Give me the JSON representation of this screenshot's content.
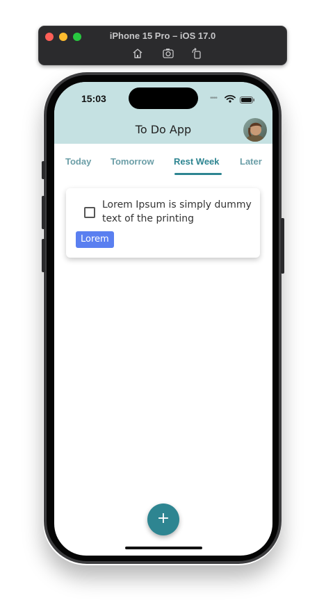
{
  "simulator": {
    "title": "iPhone 15 Pro – iOS 17.0",
    "buttons": [
      "home-icon",
      "screenshot-icon",
      "rotate-icon"
    ]
  },
  "status_bar": {
    "time": "15:03",
    "dots": "••••",
    "icons": [
      "wifi-icon",
      "battery-icon"
    ]
  },
  "app": {
    "title": "To Do App",
    "avatar": "user-avatar"
  },
  "tabs": [
    {
      "label": "Today",
      "selected": false
    },
    {
      "label": "Tomorrow",
      "selected": false
    },
    {
      "label": "Rest Week",
      "selected": true
    },
    {
      "label": "Later",
      "selected": false
    }
  ],
  "tasks": [
    {
      "text": "Lorem Ipsum is simply dummy text of the printing",
      "checked": false,
      "tag": "Lorem"
    }
  ],
  "fab": {
    "label": "+"
  },
  "colors": {
    "header": "#c5e1e2",
    "accent": "#2e8591",
    "tab_inactive": "#6b9ea7",
    "tag": "#5a7ff0"
  }
}
